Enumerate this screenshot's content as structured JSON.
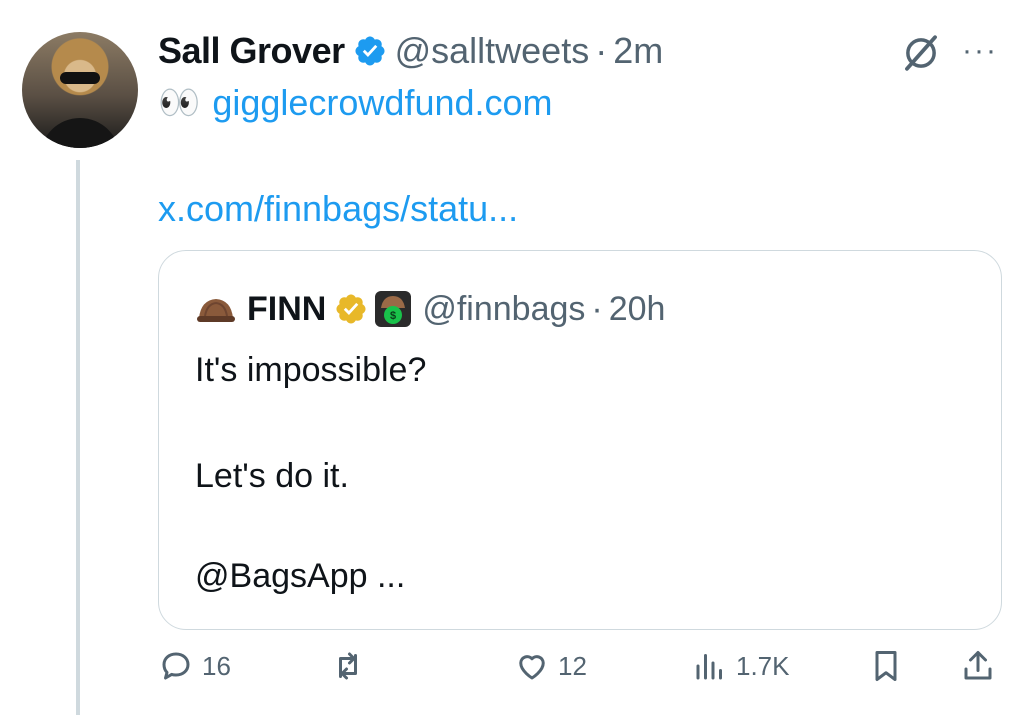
{
  "author": {
    "name": "Sall Grover",
    "handle": "@salltweets",
    "time": "2m"
  },
  "tweet": {
    "eyes_emoji": "👀",
    "link1": "gigglecrowdfund.com",
    "link2": "x.com/finnbags/statu..."
  },
  "quote": {
    "hat_emoji": "hat-icon",
    "name": "FINN",
    "handle": "@finnbags",
    "time": "20h",
    "text_lines": [
      "It's impossible?",
      "Let's do it.",
      "@BagsApp ..."
    ]
  },
  "actions": {
    "replies": "16",
    "likes": "12",
    "views": "1.7K"
  },
  "separator": "·",
  "colors": {
    "link": "#1d9bf0",
    "muted": "#536471",
    "verified_blue": "#1d9bf0",
    "verified_gold": "#e8b829",
    "border": "#cfd9de"
  }
}
